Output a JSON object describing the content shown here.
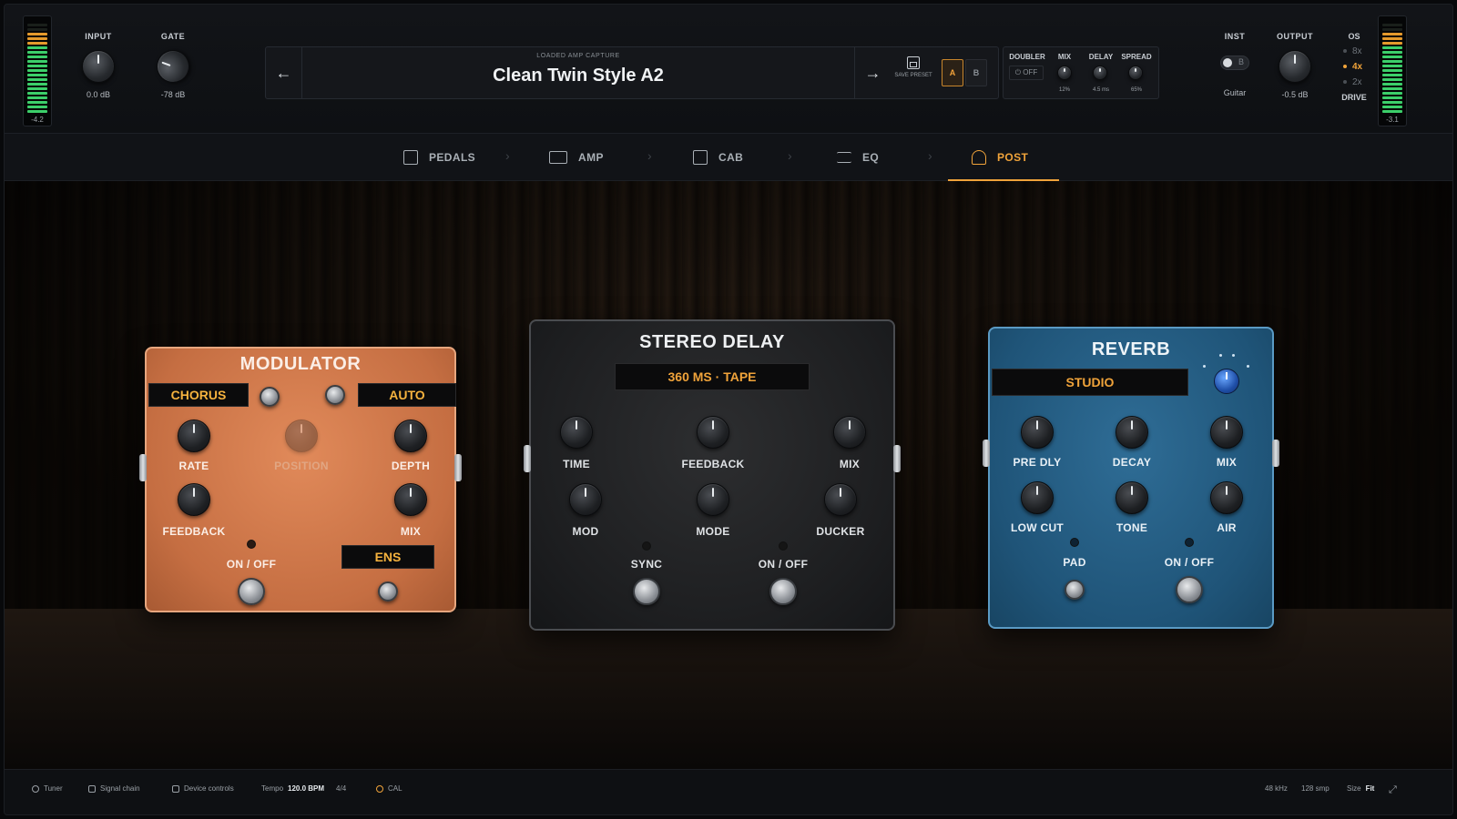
{
  "top": {
    "meter_left_value": "-4.2",
    "meter_right_value": "-3.1",
    "input": {
      "label": "INPUT",
      "value": "0.0 dB"
    },
    "gate": {
      "label": "GATE",
      "value": "-78 dB"
    },
    "preset": {
      "caption": "LOADED AMP CAPTURE",
      "name": "Clean Twin Style A2",
      "save_label": "SAVE PRESET",
      "slot_a": "A",
      "slot_b": "B"
    },
    "doubler": {
      "label": "DOUBLER",
      "power": "OFF",
      "mix_label": "MIX",
      "mix_value": "12%",
      "delay_label": "DELAY",
      "delay_value": "4.5 ms",
      "spread_label": "SPREAD",
      "spread_value": "65%"
    },
    "inst": {
      "label": "INST",
      "toggle_letter": "B",
      "value": "Guitar"
    },
    "output": {
      "label": "OUTPUT",
      "value": "-0.5 dB"
    },
    "os": {
      "label": "OS",
      "options": [
        "8x",
        "4x",
        "2x"
      ],
      "selected": "4x",
      "drive": "DRIVE"
    }
  },
  "tabs": [
    {
      "label": "PEDALS",
      "icon": "pedal-icon"
    },
    {
      "label": "AMP",
      "icon": "amp-icon"
    },
    {
      "label": "CAB",
      "icon": "cab-icon"
    },
    {
      "label": "EQ",
      "icon": "eq-sliders-icon"
    },
    {
      "label": "POST",
      "icon": "gauge-icon",
      "active": true
    }
  ],
  "modulator": {
    "title": "MODULATOR",
    "mode": "CHORUS",
    "sync": "AUTO",
    "knobs": {
      "rate": "RATE",
      "position": "POSITION",
      "depth": "DEPTH",
      "feedback": "FEEDBACK",
      "mix": "MIX"
    },
    "onoff": "ON / OFF",
    "ens": "ENS",
    "color": "#c56e42"
  },
  "stereo_delay": {
    "title": "STEREO DELAY",
    "display": "360 MS · TAPE",
    "knobs": {
      "time": "TIME",
      "feedback": "FEEDBACK",
      "mix": "MIX",
      "mod": "MOD",
      "mode": "MODE",
      "ducker": "DUCKER"
    },
    "sync": "SYNC",
    "onoff": "ON / OFF"
  },
  "reverb": {
    "title": "REVERB",
    "display": "STUDIO",
    "knobs": {
      "predly": "PRE DLY",
      "decay": "DECAY",
      "mix": "MIX",
      "lowcut": "LOW CUT",
      "tone": "TONE",
      "air": "AIR"
    },
    "pad": "PAD",
    "onoff": "ON / OFF",
    "color": "#1f5478"
  },
  "status": {
    "tuner": "Tuner",
    "signal_chain": "Signal chain",
    "device_controls": "Device controls",
    "tempo_label": "Tempo",
    "tempo_value": "120.0 BPM",
    "time_sig": "4/4",
    "cal": "CAL",
    "sample_rate": "48 kHz",
    "buffer": "128 smp",
    "size_label": "Size",
    "size_value": "Fit"
  },
  "colors": {
    "accent": "#f0a33a",
    "meter_green": "#3ccf6a"
  }
}
